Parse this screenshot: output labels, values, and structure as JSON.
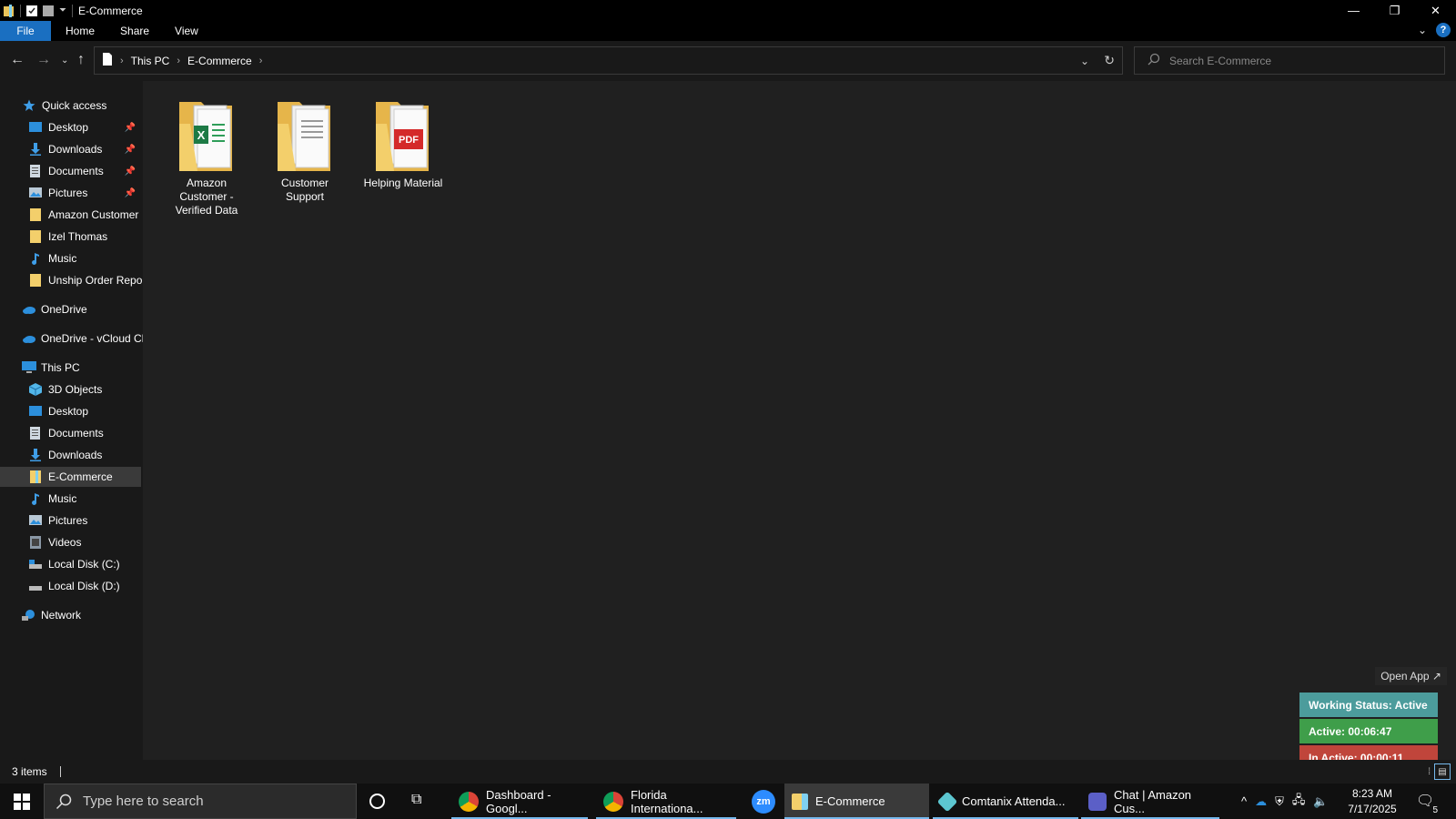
{
  "window": {
    "title": "E-Commerce",
    "minimize": "—",
    "maximize": "❐",
    "close": "✕"
  },
  "ribbon": {
    "tabs": [
      "File",
      "Home",
      "Share",
      "View"
    ],
    "help": "?"
  },
  "address": {
    "crumbs": [
      "This PC",
      "E-Commerce"
    ],
    "search_placeholder": "Search E-Commerce"
  },
  "sidebar": {
    "quick_access": "Quick access",
    "quick_items": [
      {
        "label": "Desktop",
        "pinned": true
      },
      {
        "label": "Downloads",
        "pinned": true
      },
      {
        "label": "Documents",
        "pinned": true
      },
      {
        "label": "Pictures",
        "pinned": true
      },
      {
        "label": "Amazon Customer",
        "pinned": false
      },
      {
        "label": "Izel Thomas",
        "pinned": false
      },
      {
        "label": "Music",
        "pinned": false
      },
      {
        "label": "Unship Order Repor",
        "pinned": false
      }
    ],
    "onedrive": "OneDrive",
    "onedrive_vcloud": "OneDrive - vCloud Cl",
    "this_pc": "This PC",
    "pc_items": [
      "3D Objects",
      "Desktop",
      "Documents",
      "Downloads",
      "E-Commerce",
      "Music",
      "Pictures",
      "Videos",
      "Local Disk (C:)",
      "Local Disk (D:)"
    ],
    "selected": "E-Commerce",
    "network": "Network"
  },
  "content": {
    "items": [
      {
        "name_line1": "Amazon",
        "name_line2": "Customer -",
        "name_line3": "Verified Data",
        "type": "excel-folder"
      },
      {
        "name_line1": "Customer",
        "name_line2": "Support",
        "name_line3": "",
        "type": "doc-folder"
      },
      {
        "name_line1": "Helping Material",
        "name_line2": "",
        "name_line3": "",
        "type": "pdf-folder"
      }
    ],
    "pdf_badge": "PDF"
  },
  "status": {
    "count": "3 items"
  },
  "widget": {
    "open_app": "Open App ↗",
    "working_status": "Working Status: Active",
    "active": "Active: 00:06:47",
    "inactive": "In Active: 00:00:11",
    "colors": {
      "working": "#4c9c9c",
      "active": "#3f9e4a",
      "inactive": "#c0453b"
    }
  },
  "taskbar": {
    "search_placeholder": "Type here to search",
    "apps": [
      {
        "label": "Dashboard - Googl..."
      },
      {
        "label": "Florida Internationa..."
      },
      {
        "label": "zm"
      },
      {
        "label": "E-Commerce"
      },
      {
        "label": "Comtanix Attenda..."
      },
      {
        "label": "Chat | Amazon Cus..."
      }
    ],
    "time": "8:23 AM",
    "date": "7/17/2025",
    "notifications": "5"
  }
}
